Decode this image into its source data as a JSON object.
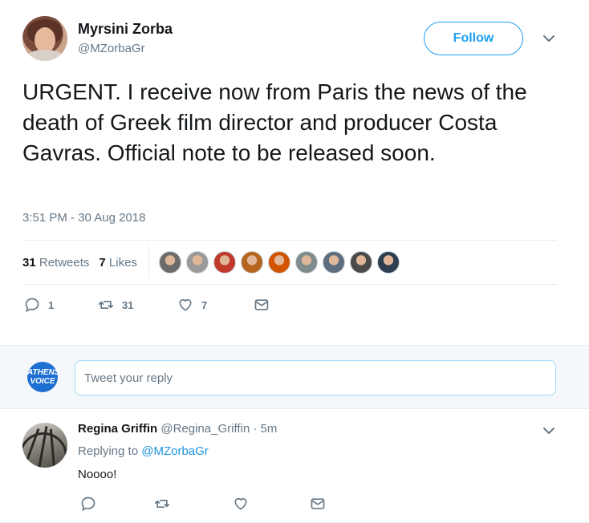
{
  "tweet": {
    "author_name": "Myrsini Zorba",
    "author_handle": "@MZorbaGr",
    "follow_label": "Follow",
    "text": "URGENT. I receive now from Paris the news of the death of Greek film director and producer Costa Gavras. Official note to be released soon.",
    "timestamp": "3:51 PM - 30 Aug 2018",
    "retweets_count": "31",
    "retweets_label": "Retweets",
    "likes_count": "7",
    "likes_label": "Likes",
    "likers": [
      "#6b6b6b",
      "#9a9a9a",
      "#c0392b",
      "#b5651d",
      "#d35400",
      "#7f8c8d",
      "#5d6d7e",
      "#4a4a4a",
      "#2c3e50"
    ],
    "actions": {
      "reply_count": "1",
      "retweet_count": "31",
      "like_count": "7"
    }
  },
  "reply_box": {
    "logo_line1": "ATHENS",
    "logo_line2": "VOICE",
    "placeholder": "Tweet your reply"
  },
  "reply": {
    "author_name": "Regina Griffin",
    "author_handle": "@Regina_Griffin",
    "time": "· 5m",
    "replying_prefix": "Replying to",
    "replying_handle": "@MZorbaGr",
    "text": "Noooo!"
  },
  "colors": {
    "accent": "#1da1f2",
    "muted": "#657786",
    "text": "#14171a",
    "border": "#e6ecf0"
  }
}
